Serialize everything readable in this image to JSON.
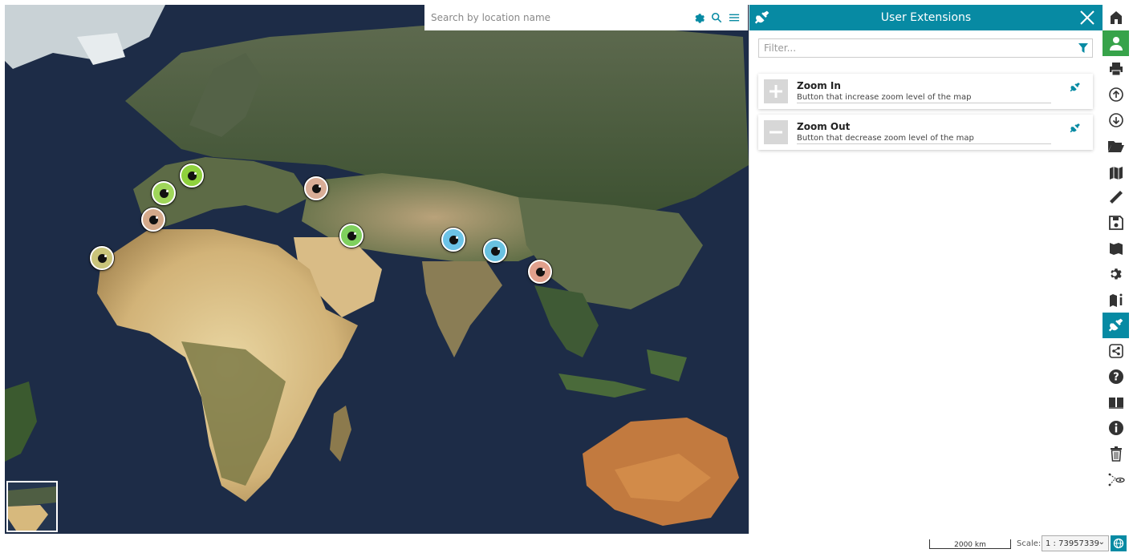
{
  "search": {
    "placeholder": "Search by location name"
  },
  "map": {
    "markers": [
      {
        "color": "#9fd65a",
        "label": "marker-france"
      },
      {
        "color": "#8fd13d",
        "label": "marker-italy"
      },
      {
        "color": "#d4a98a",
        "label": "marker-spain"
      },
      {
        "color": "#c9c47a",
        "label": "marker-canary"
      },
      {
        "color": "#d9ad96",
        "label": "marker-turkey"
      },
      {
        "color": "#7fd05e",
        "label": "marker-syria"
      },
      {
        "color": "#6cc3e7",
        "label": "marker-nepal"
      },
      {
        "color": "#69c1e0",
        "label": "marker-bangladesh"
      },
      {
        "color": "#e0a08c",
        "label": "marker-myanmar"
      }
    ]
  },
  "panel": {
    "title": "User Extensions",
    "filter_placeholder": "Filter...",
    "extensions": [
      {
        "name": "Zoom In",
        "description": "Button that increase zoom level of the map",
        "thumb_icon": "plus-icon"
      },
      {
        "name": "Zoom Out",
        "description": "Button that decrease zoom level of the map",
        "thumb_icon": "minus-icon"
      }
    ]
  },
  "toolbar": {
    "items": [
      "home-icon",
      "user-icon",
      "print-icon",
      "upload-icon",
      "download-icon",
      "folder-open-icon",
      "catalog-icon",
      "measure-icon",
      "save-icon",
      "map-book-icon",
      "gear-icon",
      "map-info-icon",
      "plug-icon",
      "share-icon",
      "help-icon",
      "book-icon",
      "info-icon",
      "trash-icon",
      "annotation-icon"
    ]
  },
  "footer": {
    "scalebar_label": "2000 km",
    "scale_label": "Scale:",
    "scale_value": "1 : 73957339"
  },
  "colors": {
    "accent": "#078aa3",
    "user_green": "#37a34a"
  }
}
